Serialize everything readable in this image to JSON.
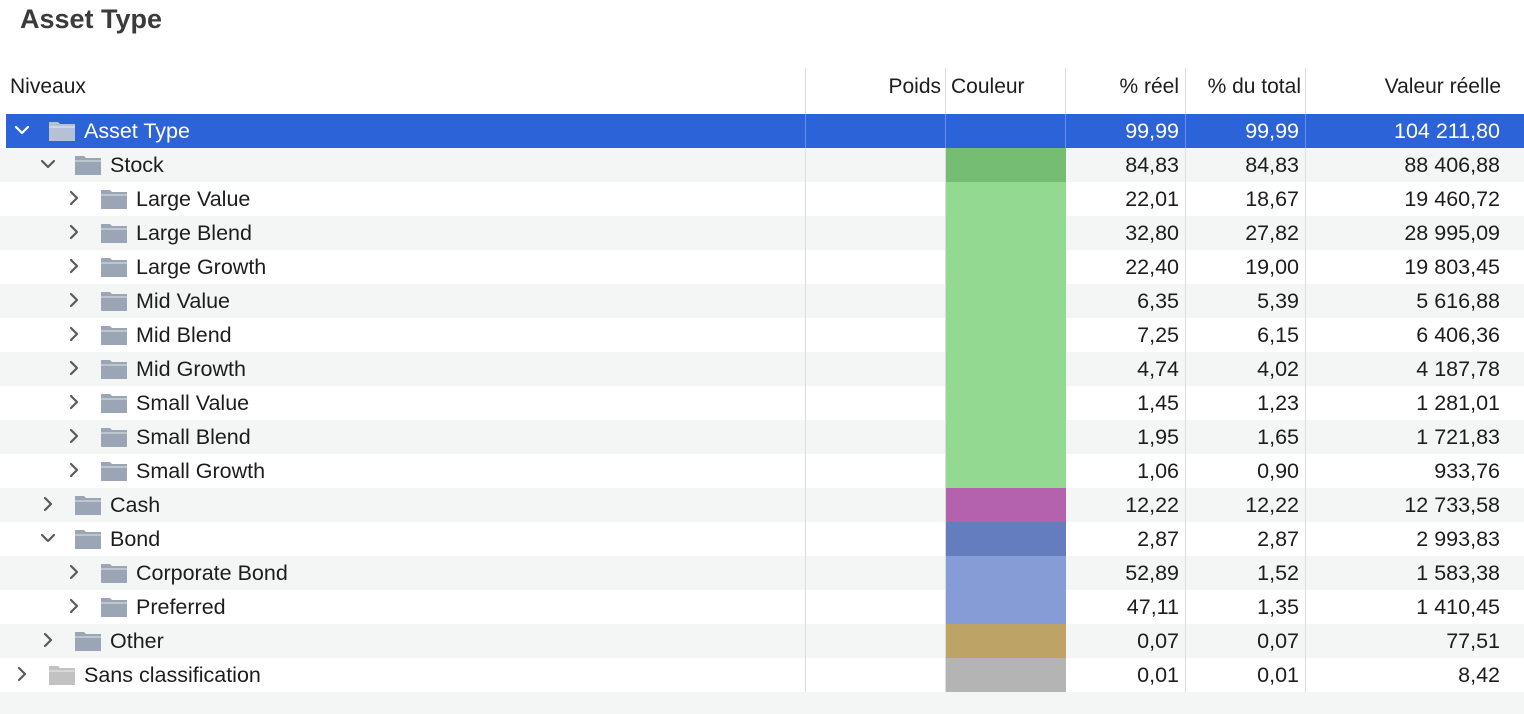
{
  "title": "Asset Type",
  "columns": {
    "niveaux": "Niveaux",
    "poids": "Poids",
    "couleur": "Couleur",
    "reel": "% réel",
    "total": "% du total",
    "valeur": "Valeur réelle"
  },
  "rows": [
    {
      "label": "Asset Type",
      "level": 0,
      "expanded": true,
      "selected": true,
      "icon": "folder-icon",
      "color": "",
      "reel": "99,99",
      "total": "99,99",
      "valeur": "104 211,80"
    },
    {
      "label": "Stock",
      "level": 1,
      "expanded": true,
      "icon": "folder-icon",
      "color": "#76bd74",
      "reel": "84,83",
      "total": "84,83",
      "valeur": "88 406,88"
    },
    {
      "label": "Large Value",
      "level": 2,
      "expanded": false,
      "icon": "folder-icon",
      "color": "#93d991",
      "reel": "22,01",
      "total": "18,67",
      "valeur": "19 460,72"
    },
    {
      "label": "Large Blend",
      "level": 2,
      "expanded": false,
      "icon": "folder-icon",
      "color": "#93d991",
      "reel": "32,80",
      "total": "27,82",
      "valeur": "28 995,09"
    },
    {
      "label": "Large Growth",
      "level": 2,
      "expanded": false,
      "icon": "folder-icon",
      "color": "#93d991",
      "reel": "22,40",
      "total": "19,00",
      "valeur": "19 803,45"
    },
    {
      "label": "Mid Value",
      "level": 2,
      "expanded": false,
      "icon": "folder-icon",
      "color": "#93d991",
      "reel": "6,35",
      "total": "5,39",
      "valeur": "5 616,88"
    },
    {
      "label": "Mid Blend",
      "level": 2,
      "expanded": false,
      "icon": "folder-icon",
      "color": "#93d991",
      "reel": "7,25",
      "total": "6,15",
      "valeur": "6 406,36"
    },
    {
      "label": "Mid Growth",
      "level": 2,
      "expanded": false,
      "icon": "folder-icon",
      "color": "#93d991",
      "reel": "4,74",
      "total": "4,02",
      "valeur": "4 187,78"
    },
    {
      "label": "Small Value",
      "level": 2,
      "expanded": false,
      "icon": "folder-icon",
      "color": "#93d991",
      "reel": "1,45",
      "total": "1,23",
      "valeur": "1 281,01"
    },
    {
      "label": "Small Blend",
      "level": 2,
      "expanded": false,
      "icon": "folder-icon",
      "color": "#93d991",
      "reel": "1,95",
      "total": "1,65",
      "valeur": "1 721,83"
    },
    {
      "label": "Small Growth",
      "level": 2,
      "expanded": false,
      "icon": "folder-icon",
      "color": "#93d991",
      "reel": "1,06",
      "total": "0,90",
      "valeur": "933,76"
    },
    {
      "label": "Cash",
      "level": 1,
      "expanded": false,
      "icon": "folder-icon",
      "color": "#b562ae",
      "reel": "12,22",
      "total": "12,22",
      "valeur": "12 733,58"
    },
    {
      "label": "Bond",
      "level": 1,
      "expanded": true,
      "icon": "folder-icon",
      "color": "#637dbf",
      "reel": "2,87",
      "total": "2,87",
      "valeur": "2 993,83"
    },
    {
      "label": "Corporate Bond",
      "level": 2,
      "expanded": false,
      "icon": "folder-icon",
      "color": "#859cd7",
      "reel": "52,89",
      "total": "1,52",
      "valeur": "1 583,38"
    },
    {
      "label": "Preferred",
      "level": 2,
      "expanded": false,
      "icon": "folder-icon",
      "color": "#859cd7",
      "reel": "47,11",
      "total": "1,35",
      "valeur": "1 410,45"
    },
    {
      "label": "Other",
      "level": 1,
      "expanded": false,
      "icon": "folder-icon",
      "color": "#bda466",
      "reel": "0,07",
      "total": "0,07",
      "valeur": "77,51"
    },
    {
      "label": "Sans classification",
      "level": 0,
      "expanded": false,
      "icon": "folder-icon",
      "color": "#b4b4b4",
      "folder_color": "#c2c2c2",
      "reel": "0,01",
      "total": "0,01",
      "valeur": "8,42"
    }
  ]
}
